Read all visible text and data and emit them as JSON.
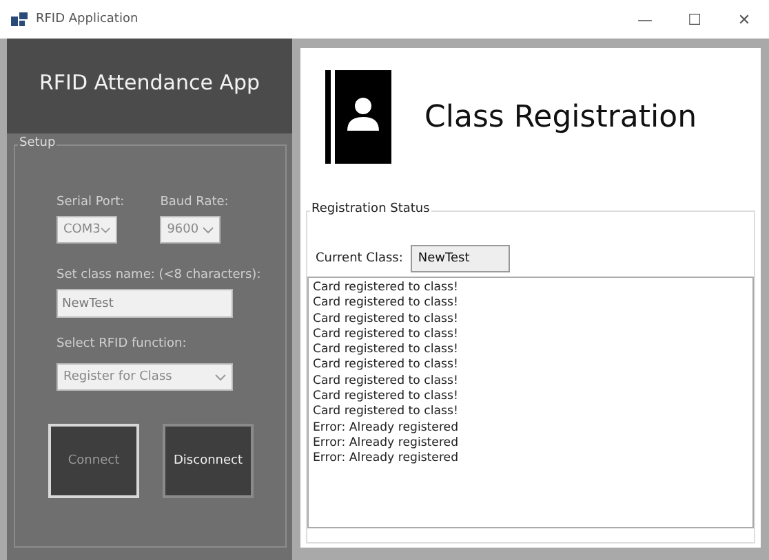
{
  "window": {
    "title": "RFID Application",
    "controls": [
      "—",
      "☐",
      "✕"
    ]
  },
  "header": {
    "title": "RFID Attendance App"
  },
  "setup": {
    "legend": "Setup",
    "serial_port": {
      "label": "Serial Port:",
      "value": "COM3"
    },
    "baud_rate": {
      "label": "Baud Rate:",
      "value": "9600"
    },
    "class_name": {
      "label": "Set class name: (<8 characters):",
      "value": "NewTest"
    },
    "function": {
      "label": "Select RFID function:",
      "value": "Register for Class"
    },
    "buttons": [
      {
        "label": "Connect",
        "disabled": true
      },
      {
        "label": "Disconnect",
        "disabled": false
      }
    ]
  },
  "page": {
    "title": "Class Registration"
  },
  "status": {
    "legend": "Registration Status",
    "current_class_label": "Current Class:",
    "current_class": "NewTest",
    "log": [
      "Card registered to class!",
      "Card registered to class!",
      "Card registered to class!",
      "Card registered to class!",
      "Card registered to class!",
      "Card registered to class!",
      "Card registered to class!",
      "Card registered to class!",
      "Card registered to class!",
      "Error: Already registered",
      "Error: Already registered",
      "Error: Already registered"
    ]
  }
}
